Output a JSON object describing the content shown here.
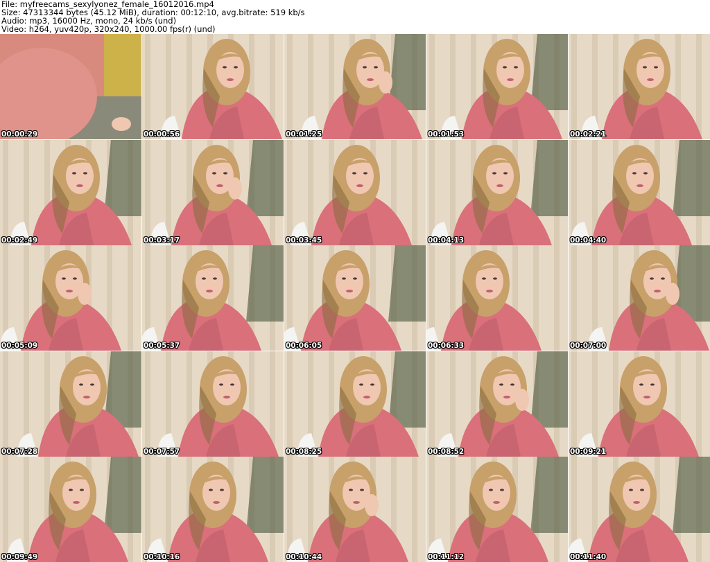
{
  "header": {
    "file_line": "File: myfreecams_sexylyonez_female_16012016.mp4",
    "size_line": "Size: 47313344 bytes (45.12 MiB), duration: 00:12:10, avg.bitrate: 519 kb/s",
    "audio_line": "Audio: mp3, 16000 Hz, mono, 24 kb/s (und)",
    "video_line": "Video: h264, yuv420p, 320x240, 1000.00 fps(r) (und)"
  },
  "thumbnails": [
    {
      "timestamp": "00:00:29"
    },
    {
      "timestamp": "00:00:56"
    },
    {
      "timestamp": "00:01:25"
    },
    {
      "timestamp": "00:01:53"
    },
    {
      "timestamp": "00:02:21"
    },
    {
      "timestamp": "00:02:49"
    },
    {
      "timestamp": "00:03:17"
    },
    {
      "timestamp": "00:03:45"
    },
    {
      "timestamp": "00:04:13"
    },
    {
      "timestamp": "00:04:40"
    },
    {
      "timestamp": "00:05:09"
    },
    {
      "timestamp": "00:05:37"
    },
    {
      "timestamp": "00:06:05"
    },
    {
      "timestamp": "00:06:33"
    },
    {
      "timestamp": "00:07:00"
    },
    {
      "timestamp": "00:07:28"
    },
    {
      "timestamp": "00:07:57"
    },
    {
      "timestamp": "00:08:25"
    },
    {
      "timestamp": "00:08:52"
    },
    {
      "timestamp": "00:09:21"
    },
    {
      "timestamp": "00:09:49"
    },
    {
      "timestamp": "00:10:16"
    },
    {
      "timestamp": "00:10:44"
    },
    {
      "timestamp": "00:11:12"
    },
    {
      "timestamp": "00:11:40"
    }
  ],
  "colors": {
    "curtain": "#e6dac6",
    "curtain_fold": "#cfc0a8",
    "sweater": "#d9707a",
    "sweater_shadow": "#b85a65",
    "hair": "#c8a06a",
    "hair_dark": "#8a6a40",
    "skin": "#f0c7b0",
    "tree": "#3a4a30",
    "chair": "#f4f4f2"
  }
}
